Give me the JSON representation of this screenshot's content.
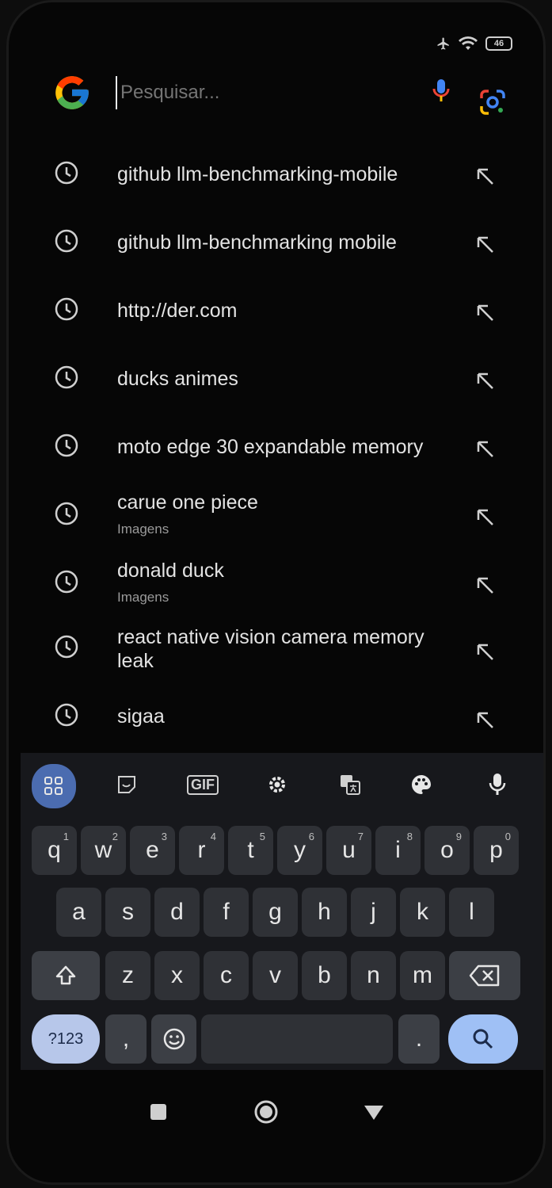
{
  "status": {
    "battery": "46"
  },
  "search": {
    "placeholder": "Pesquisar..."
  },
  "suggestions": [
    {
      "text": "github llm-benchmarking-mobile",
      "sub": ""
    },
    {
      "text": "github llm-benchmarking mobile",
      "sub": ""
    },
    {
      "text": "http://der.com",
      "sub": ""
    },
    {
      "text": "ducks animes",
      "sub": ""
    },
    {
      "text": "moto edge 30 expandable memory",
      "sub": ""
    },
    {
      "text": "carue one piece",
      "sub": "Imagens"
    },
    {
      "text": "donald duck",
      "sub": "Imagens"
    },
    {
      "text": "react native vision camera memory",
      "text2": "leak",
      "sub": ""
    },
    {
      "text": "sigaa",
      "sub": ""
    }
  ],
  "keyboard": {
    "toolbar": [
      "apps-grid-icon",
      "sticker-icon",
      "gif-icon",
      "settings-gear-icon",
      "translate-icon",
      "palette-icon",
      "mic-icon"
    ],
    "gif_label": "GIF",
    "row1": [
      {
        "k": "q",
        "n": "1"
      },
      {
        "k": "w",
        "n": "2"
      },
      {
        "k": "e",
        "n": "3"
      },
      {
        "k": "r",
        "n": "4"
      },
      {
        "k": "t",
        "n": "5"
      },
      {
        "k": "y",
        "n": "6"
      },
      {
        "k": "u",
        "n": "7"
      },
      {
        "k": "i",
        "n": "8"
      },
      {
        "k": "o",
        "n": "9"
      },
      {
        "k": "p",
        "n": "0"
      }
    ],
    "row2": [
      "a",
      "s",
      "d",
      "f",
      "g",
      "h",
      "j",
      "k",
      "l"
    ],
    "row3": [
      "z",
      "x",
      "c",
      "v",
      "b",
      "n",
      "m"
    ],
    "num_label": "?123",
    "comma": ",",
    "period": "."
  },
  "nav": [
    "recents-square-icon",
    "home-circle-icon",
    "back-triangle-icon"
  ],
  "colors": {
    "background": "#060606",
    "text": "#e3e3e3",
    "accent": "#9fc0f5",
    "keyboard": "#17181c"
  }
}
